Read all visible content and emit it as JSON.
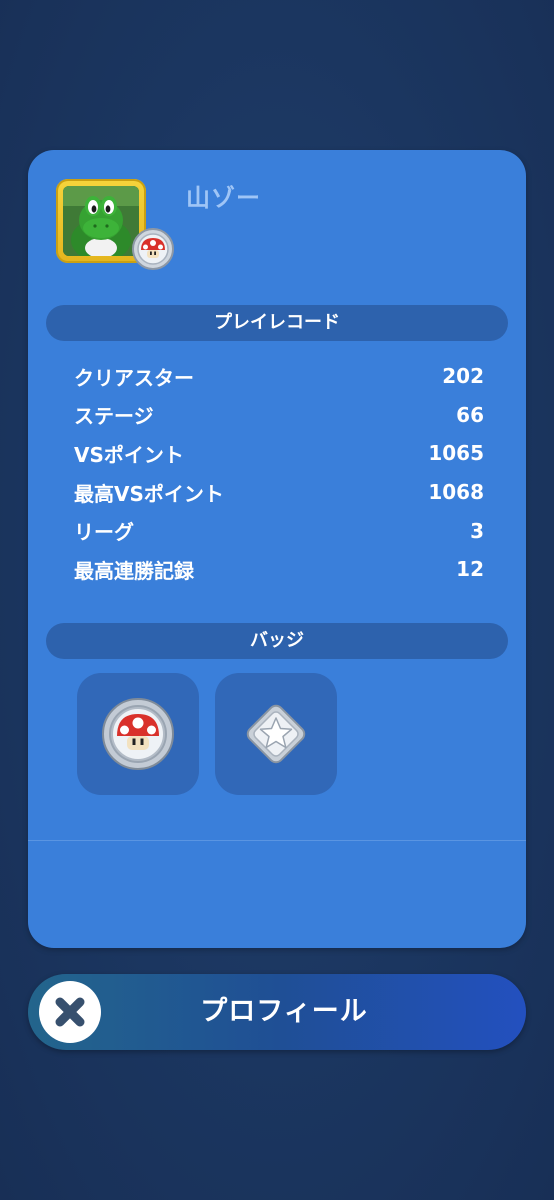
{
  "profile": {
    "name": "山ゾー",
    "avatar_icon": "yoshi-avatar-icon",
    "rank_badge_icon": "super-mushroom-badge-icon"
  },
  "play_record": {
    "title": "プレイレコード",
    "rows": [
      {
        "label": "クリアスター",
        "value": "202"
      },
      {
        "label": "ステージ",
        "value": "66"
      },
      {
        "label": "VSポイント",
        "value": "1065"
      },
      {
        "label": "最高VSポイント",
        "value": "1068"
      },
      {
        "label": "リーグ",
        "value": "3"
      },
      {
        "label": "最高連勝記録",
        "value": "12"
      }
    ]
  },
  "badges": {
    "title": "バッジ",
    "items": [
      {
        "icon": "super-mushroom-badge-icon"
      },
      {
        "icon": "silver-star-badge-icon"
      }
    ]
  },
  "footer": {
    "title": "プロフィール",
    "close_icon": "close-icon"
  },
  "colors": {
    "background": "#1b3760",
    "card": "#3a7fda",
    "section_bar": "#2d62ad",
    "badge_tile": "#3168b8",
    "name_text": "#9fc5f6",
    "avatar_frame": "#f6d43c"
  }
}
